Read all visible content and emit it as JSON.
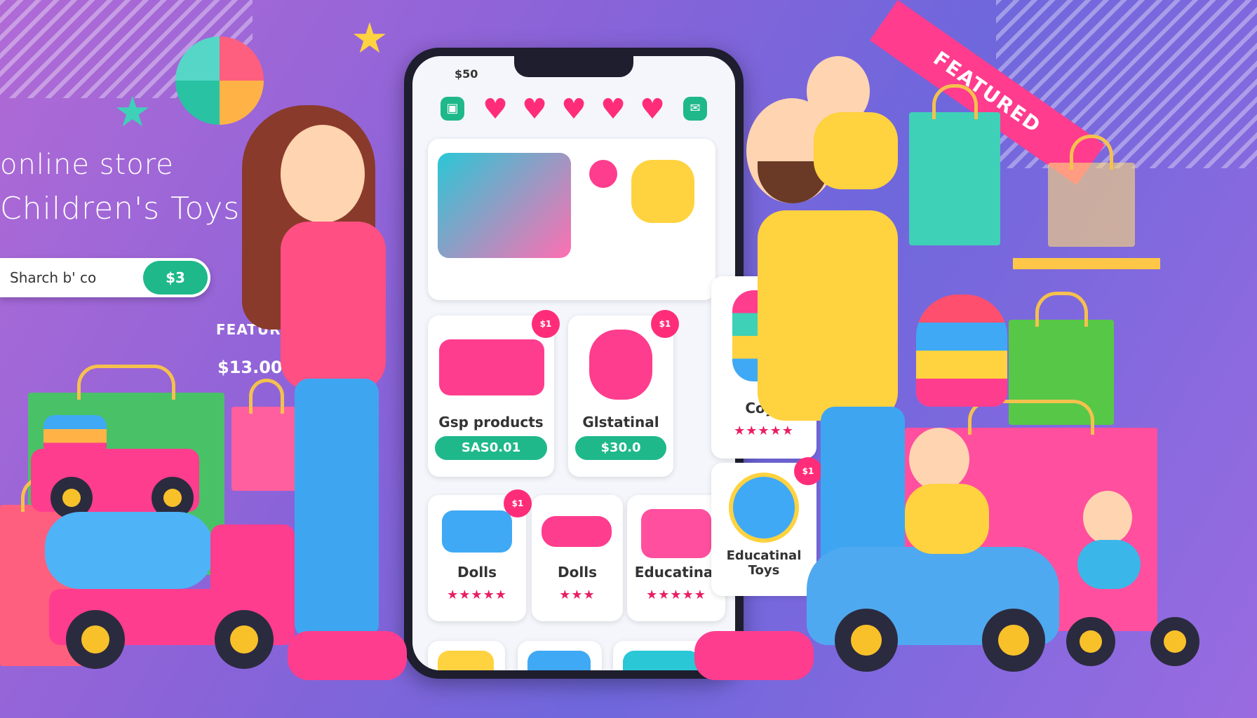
{
  "hero": {
    "title_line1": "online store",
    "title_line2": "Children's Toys",
    "search_placeholder": "Sharch b' co",
    "search_button": "$3",
    "featured_label": "FEATURED",
    "featured_price": "$13.00",
    "ribbon_label": "FEATURED"
  },
  "phone": {
    "status_time": "$50",
    "left_icon": "bag-icon",
    "right_icon": "chat-icon",
    "hearts": 5,
    "products": [
      {
        "name": "",
        "price": "",
        "badge": ""
      },
      {
        "name": "",
        "price": "",
        "badge": ""
      },
      {
        "name": "Gsp products",
        "price": "SAS0.01",
        "badge": "$1"
      },
      {
        "name": "Glstatinal",
        "price": "$30.0",
        "badge": "$1"
      },
      {
        "name": "Coys",
        "price": "",
        "badge": "",
        "stars": "★★★★★"
      },
      {
        "name": "Dolls",
        "price": "",
        "badge": "$1",
        "stars": "★★★★★"
      },
      {
        "name": "Dolls",
        "price": "",
        "badge": "",
        "stars": "★★★"
      },
      {
        "name": "Educatinal",
        "price": "",
        "badge": "",
        "stars": "★★★★★"
      },
      {
        "name": "Educatinal Toys",
        "price": "",
        "badge": "$1",
        "stars": ""
      }
    ]
  },
  "colors": {
    "accent_green": "#1fb88a",
    "accent_pink": "#ff2d79",
    "bg_purple": "#8a63d8"
  }
}
